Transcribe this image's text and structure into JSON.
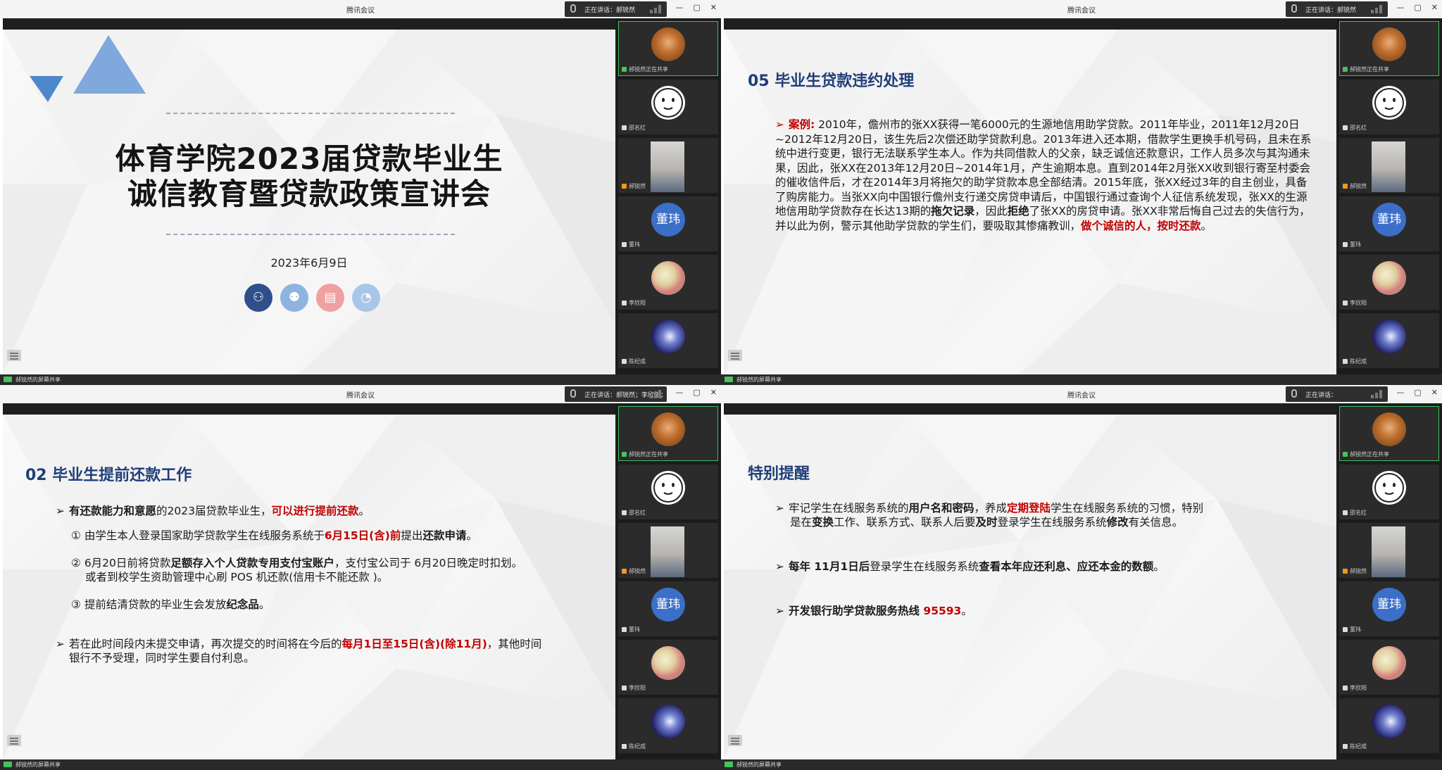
{
  "app_title": "腾讯会议",
  "window_controls": [
    "—",
    "▢",
    "✕"
  ],
  "status_text": "郝锐然的屏幕共享",
  "colors": {
    "accent_green": "#3fbf5a",
    "title_blue": "#1f3f7a",
    "highlight_red": "#c00000",
    "avatar_blue": "#3b6fc8"
  },
  "participants": [
    {
      "name": "郝锐然正在共享",
      "avatar": "photo",
      "icon": "screen-share-icon"
    },
    {
      "name": "邵名红",
      "avatar": "face-sketch",
      "icon": "mic-icon"
    },
    {
      "name": "郝锐然",
      "avatar": "video",
      "icon": "user-icon"
    },
    {
      "name": "董玮",
      "avatar": "text",
      "avatar_text": "董玮",
      "icon": "mic-icon"
    },
    {
      "name": "李欣阳",
      "avatar": "food",
      "icon": "mic-icon"
    },
    {
      "name": "陈纪成",
      "avatar": "space",
      "icon": "mic-icon"
    }
  ],
  "windows": [
    {
      "speaker": "正在讲话：郝锐然"
    },
    {
      "speaker": "正在讲话：郝锐然"
    },
    {
      "speaker": "正在讲话：郝锐然；李欣阳；"
    },
    {
      "speaker": "正在讲话："
    }
  ],
  "slide_title": {
    "line1": "体育学院2023届贷款毕业生",
    "line2": "诚信教育暨贷款政策宣讲会",
    "date": "2023年6月9日"
  },
  "slide_case": {
    "section": "05  毕业生贷款违约处理",
    "label": "案例:",
    "body_1": " 2010年，儋州市的张XX获得一笔6000元的生源地信用助学贷款。2011年毕业，2011年12月20日~2012年12月20日，该生先后2次偿还助学贷款利息。2013年进入还本期，借款学生更换手机号码，且未在系统中进行变更，银行无法联系学生本人。作为共同借款人的父亲，缺乏诚信还款意识，工作人员多次与其沟通未果，因此，张XX在2013年12月20日~2014年1月，产生逾期本息。直到2014年2月张XX收到银行寄至村委会的催收信件后，才在2014年3月将拖欠的助学贷款本息全部结清。2015年底，张XX经过3年的自主创业，具备了购房能力。当张XX向中国银行儋州支行递交房贷申请后，中国银行通过查询个人征信系统发现，张XX的生源地信用助学贷款存在长达13期的",
    "bold_1": "拖欠记录",
    "body_2": "，因此",
    "bold_2": "拒绝",
    "body_3": "了张XX的房贷申请。张XX非常后悔自己过去的失信行为，并以此为例，警示其他助学贷款的学生们，要吸取其惨痛教训，",
    "red_end": "做个诚信的人，按时还款",
    "end": "。"
  },
  "slide_prepay": {
    "section": "02  毕业生提前还款工作",
    "p1_bold": "有还款能力和意愿",
    "p1_mid": "的2023届贷款毕业生，",
    "p1_red": "可以进行提前还款",
    "p1_end": "。",
    "i1_pre": "① 由学生本人登录国家助学贷款学生在线服务系统于",
    "i1_red": "6月15日(含)前",
    "i1_mid": "提出",
    "i1_bold": "还款申请",
    "i1_end": "。",
    "i2_pre": "② 6月20日前将贷款",
    "i2_bold": "足额存入个人贷款专用支付宝账户",
    "i2_end": "，支付宝公司于 6月20日晚定时扣划。",
    "i2_line2": "或者到校学生资助管理中心刷 POS 机还款(信用卡不能还款 )。",
    "i3_pre": "③  提前结清贷款的毕业生会发放",
    "i3_bold": "纪念品",
    "i3_end": "。",
    "p2_pre": "若在此时间段内未提交申请，再次提交的时间将在今后的",
    "p2_red": "每月1日至15日(含)(除11月)",
    "p2_end": "，其他时间",
    "p2_line2": "银行不予受理，同时学生要自付利息。"
  },
  "slide_reminder": {
    "section": "特别提醒",
    "r1_pre": "牢记学生在线服务系统的",
    "r1_b1": "用户名和密码",
    "r1_mid": "，养成",
    "r1_red": "定期登陆",
    "r1_end": "学生在线服务系统的习惯，特别",
    "r1_l2_pre": "是在",
    "r1_l2_b1": "变换",
    "r1_l2_mid": "工作、联系方式、联系人后要",
    "r1_l2_b2": "及时",
    "r1_l2_mid2": "登录学生在线服务系统",
    "r1_l2_b3": "修改",
    "r1_l2_end": "有关信息。",
    "r2_b1": "每年 11月1日后",
    "r2_mid": "登录学生在线服务系统",
    "r2_b2": "查看本年应还利息、应还本金的数额",
    "r2_end": "。",
    "r3_b": "开发银行助学贷款服务热线 ",
    "r3_red": "95593",
    "r3_end": "。"
  }
}
